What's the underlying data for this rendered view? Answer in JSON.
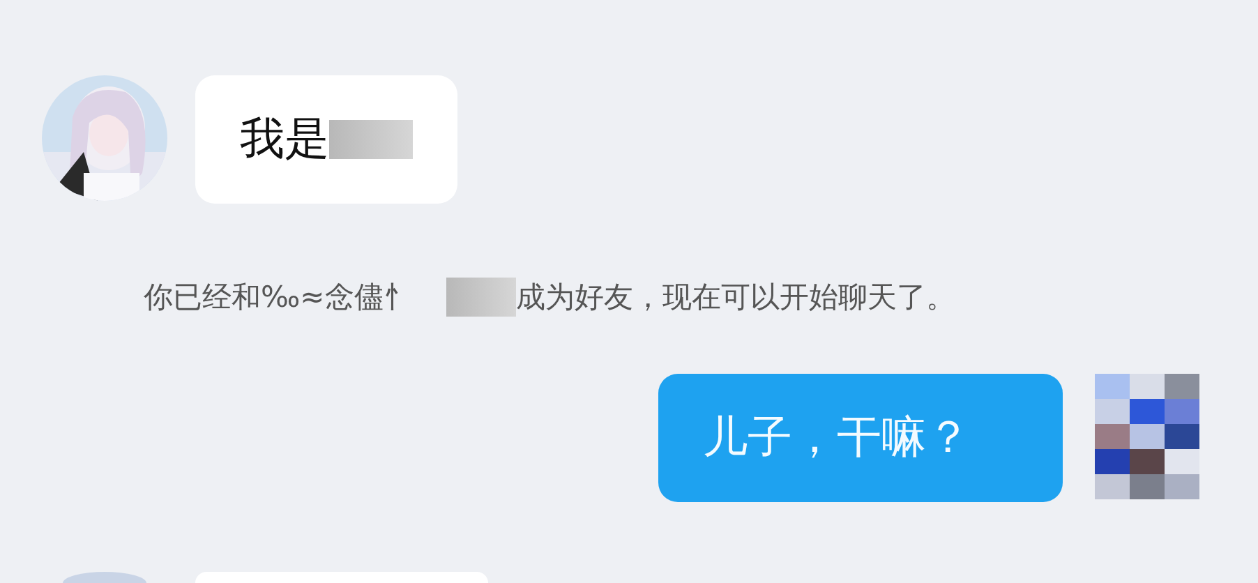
{
  "messages": [
    {
      "kind": "incoming",
      "text": "我是",
      "redacted": true
    },
    {
      "kind": "system",
      "text_before": "你已经和‰≈念儘忄",
      "redacted": true,
      "text_after": "成为好友，现在可以开始聊天了。"
    },
    {
      "kind": "outgoing",
      "text": "儿子，干嘛？"
    },
    {
      "kind": "incoming_cut"
    }
  ]
}
